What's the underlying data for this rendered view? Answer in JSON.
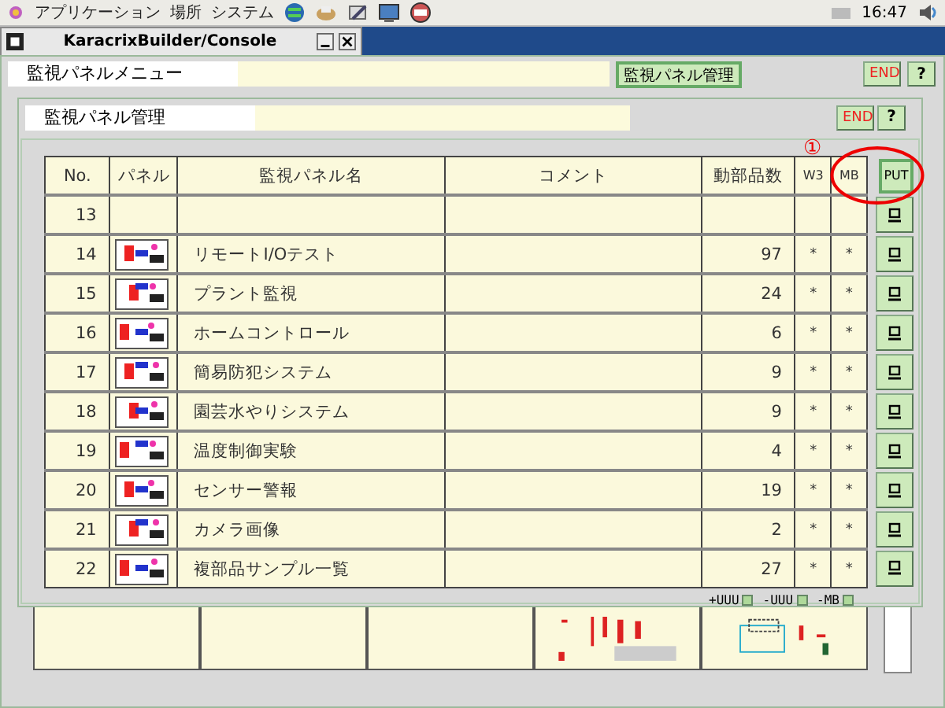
{
  "top_panel": {
    "menus": [
      "アプリケーション",
      "場所",
      "システム"
    ],
    "clock": "16:47"
  },
  "console_window": {
    "title": "KaracrixBuilder/Console"
  },
  "main_window": {
    "title_field": "監視パネルメニュー",
    "mode_button": "監視パネル管理",
    "end_button": "END",
    "help_button": "?"
  },
  "dialog": {
    "title_field": "監視パネル管理",
    "end_button": "END",
    "help_button": "?",
    "annotation": "①",
    "columns": [
      "No.",
      "パネル",
      "監視パネル名",
      "コメント",
      "動部品数",
      "W3",
      "MB"
    ],
    "put_button": "PUT",
    "rows": [
      {
        "no": "13",
        "thumbnail": false,
        "name": "",
        "comment": "",
        "parts": "",
        "w3": "",
        "mb": ""
      },
      {
        "no": "14",
        "thumbnail": true,
        "name": "リモートI/Oテスト",
        "comment": "",
        "parts": "97",
        "w3": "*",
        "mb": "*"
      },
      {
        "no": "15",
        "thumbnail": true,
        "name": "プラント監視",
        "comment": "",
        "parts": "24",
        "w3": "*",
        "mb": "*"
      },
      {
        "no": "16",
        "thumbnail": true,
        "name": "ホームコントロール",
        "comment": "",
        "parts": "6",
        "w3": "*",
        "mb": "*"
      },
      {
        "no": "17",
        "thumbnail": true,
        "name": "簡易防犯システム",
        "comment": "",
        "parts": "9",
        "w3": "*",
        "mb": "*"
      },
      {
        "no": "18",
        "thumbnail": true,
        "name": "園芸水やりシステム",
        "comment": "",
        "parts": "9",
        "w3": "*",
        "mb": "*"
      },
      {
        "no": "19",
        "thumbnail": true,
        "name": "温度制御実験",
        "comment": "",
        "parts": "4",
        "w3": "*",
        "mb": "*"
      },
      {
        "no": "20",
        "thumbnail": true,
        "name": "センサー警報",
        "comment": "",
        "parts": "19",
        "w3": "*",
        "mb": "*"
      },
      {
        "no": "21",
        "thumbnail": true,
        "name": "カメラ画像",
        "comment": "",
        "parts": "2",
        "w3": "*",
        "mb": "*"
      },
      {
        "no": "22",
        "thumbnail": true,
        "name": "複部品サンプル一覧",
        "comment": "",
        "parts": "27",
        "w3": "*",
        "mb": "*"
      }
    ],
    "footer_controls": [
      "+UUU",
      "-UUU",
      "-MB"
    ]
  }
}
